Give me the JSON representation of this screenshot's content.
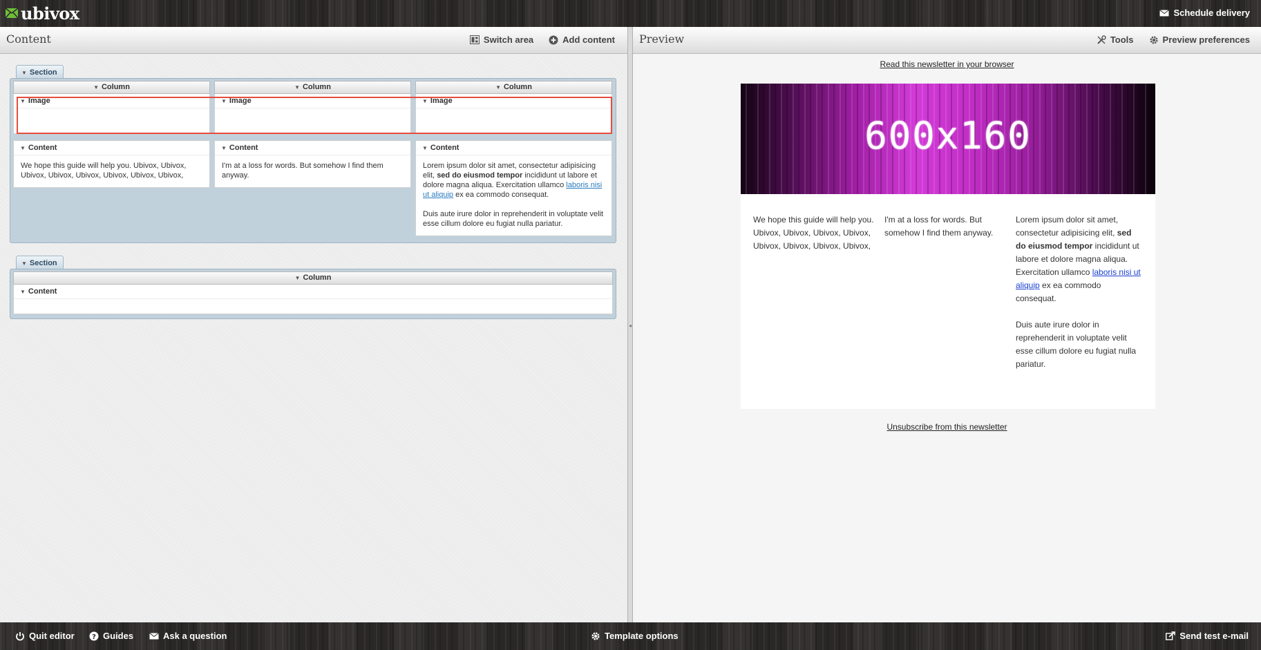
{
  "app": {
    "name": "ubivox"
  },
  "topbar": {
    "schedule_label": "Schedule delivery"
  },
  "content_panel": {
    "title": "Content",
    "switch_area_label": "Switch area",
    "add_content_label": "Add content"
  },
  "preview_panel": {
    "title": "Preview",
    "tools_label": "Tools",
    "preferences_label": "Preview preferences"
  },
  "sections": [
    {
      "label": "Section",
      "columns": [
        {
          "label": "Column",
          "image_label": "Image",
          "content_label": "Content",
          "text": "We hope this guide will help you. Ubivox, Ubivox, Ubivox, Ubivox, Ubivox, Ubivox, Ubivox, Ubivox,"
        },
        {
          "label": "Column",
          "image_label": "Image",
          "content_label": "Content",
          "text": "I'm at a loss for words. But somehow I find them anyway."
        },
        {
          "label": "Column",
          "image_label": "Image",
          "content_label": "Content",
          "p1_a": "Lorem ipsum dolor sit amet, consectetur adipisicing elit, ",
          "p1_bold": "sed do eiusmod tempor",
          "p1_b": " incididunt ut labore et dolore magna aliqua. Exercitation ullamco ",
          "p1_link": "laboris nisi ut aliquip",
          "p1_c": " ex ea commodo consequat.",
          "p2": "Duis aute irure dolor in reprehenderit in voluptate velit esse cillum dolore eu fugiat nulla pariatur."
        }
      ]
    },
    {
      "label": "Section",
      "columns": [
        {
          "label": "Column",
          "content_label": "Content"
        }
      ]
    }
  ],
  "preview": {
    "read_in_browser": "Read this newsletter in your browser",
    "banner_text": "600x160",
    "unsubscribe": "Unsubscribe from this newsletter"
  },
  "bottombar": {
    "quit_label": "Quit editor",
    "guides_label": "Guides",
    "ask_label": "Ask a question",
    "template_options_label": "Template options",
    "send_test_label": "Send test e-mail"
  },
  "colors": {
    "accent_highlight": "#e74c3c",
    "section_bg": "#c1d1dc",
    "link_editor": "#2a7bc0",
    "link_preview": "#1a3fcf"
  },
  "icons": [
    "ubivox-logo-icon",
    "envelope-icon",
    "switch-area-icon",
    "plus-circle-icon",
    "tools-icon",
    "gear-icon",
    "power-icon",
    "question-icon",
    "envelope-icon",
    "gear-icon",
    "send-icon"
  ]
}
